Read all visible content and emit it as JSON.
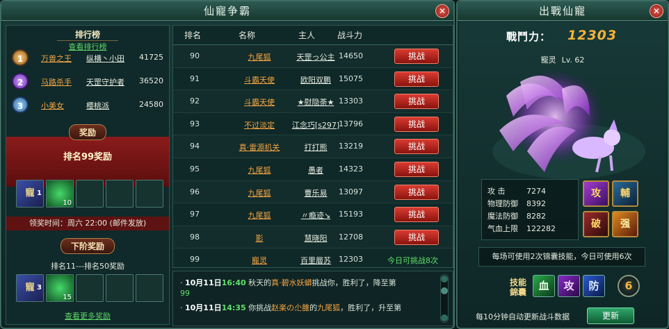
{
  "left_window": {
    "title": "仙寵争霸",
    "close_glyph": "✕"
  },
  "sidebar": {
    "rank_header": "排行榜",
    "view_rank_link": "查看排行榜",
    "top_ranks": [
      {
        "medal": "1",
        "title": "万兽之王",
        "name": "纵横丶小田",
        "power": "41725"
      },
      {
        "medal": "2",
        "title": "马路杀手",
        "name": "天罡守护者",
        "power": "36520"
      },
      {
        "medal": "3",
        "title": "小美女",
        "name": "樱桃派",
        "power": "24580"
      }
    ],
    "reward_header": "奖励",
    "reward_title": "排名99奖励",
    "reward_items": [
      {
        "icon": "pet-scroll-icon",
        "glyph": "寵",
        "qty": "1"
      },
      {
        "icon": "green-gem-icon",
        "glyph": "",
        "qty": "10"
      }
    ],
    "claim_time": "领奖时间：周六 22:00 (邮件发放)",
    "next_header": "下阶奖励",
    "next_range": "排名11---排名50奖励",
    "next_items": [
      {
        "icon": "pet-scroll-icon",
        "glyph": "寵",
        "qty": "3"
      },
      {
        "icon": "green-gem-icon",
        "glyph": "",
        "qty": "15"
      }
    ],
    "more_rewards_link": "查看更多奖励"
  },
  "table": {
    "headers": {
      "rank": "排名",
      "name": "名称",
      "owner": "主人",
      "power": "战斗力"
    },
    "challenge_label": "挑战",
    "rows": [
      {
        "rank": "90",
        "name": "九尾狐",
        "owner": "天罡っ公主",
        "power": "14650",
        "action": "button"
      },
      {
        "rank": "91",
        "name": "斗霸天使",
        "owner": "欧阳双鹏",
        "power": "15075",
        "action": "button"
      },
      {
        "rank": "92",
        "name": "斗霸天使",
        "owner": "★慰隐荼★",
        "power": "13303",
        "action": "button"
      },
      {
        "rank": "93",
        "name": "不过淡定",
        "owner": "江念巧[s297]",
        "power": "13796",
        "action": "button"
      },
      {
        "rank": "94",
        "name": "真·雷源机关",
        "owner": "打打熊",
        "power": "13219",
        "action": "button"
      },
      {
        "rank": "95",
        "name": "九尾狐",
        "owner": "愚者",
        "power": "14323",
        "action": "button"
      },
      {
        "rank": "96",
        "name": "九尾狐",
        "owner": "曹乐易",
        "power": "13097",
        "action": "button"
      },
      {
        "rank": "97",
        "name": "九尾狐",
        "owner": "〃瘾迹↘",
        "power": "15193",
        "action": "button"
      },
      {
        "rank": "98",
        "name": "影",
        "owner": "慧晓阳",
        "power": "12708",
        "action": "button"
      },
      {
        "rank": "99",
        "name": "寵灵",
        "owner": "百里層苏",
        "power": "12303",
        "action": "note"
      }
    ],
    "self_note": "今日可挑战8次"
  },
  "log": {
    "entries": [
      {
        "bullet": "·",
        "date": "10月11日",
        "time": "16:40",
        "t1": " 秋天的",
        "t2": "真·碧水妖蟒",
        "t3": "挑战你，胜利了，降至第",
        "t4": "99"
      },
      {
        "bullet": "·",
        "date": "10月11日",
        "time": "14:35",
        "t1": " 你挑战",
        "t2": "赵楽の尐雒",
        "t3": "的",
        "t4": "九尾狐",
        "t5": "，胜利了，升至第"
      }
    ]
  },
  "right_window": {
    "title": "出戰仙寵",
    "close_glyph": "✕",
    "power_label": "戰鬥力：",
    "power_value": "12303",
    "pet_name": "寵灵",
    "pet_level": "Lv. 62",
    "stats": [
      {
        "label": "攻  击",
        "value": "7274"
      },
      {
        "label": "物理防御",
        "value": "8392"
      },
      {
        "label": "魔法防御",
        "value": "8282"
      },
      {
        "label": "气血上限",
        "value": "122282"
      }
    ],
    "skills": [
      {
        "glyph": "攻",
        "icon": "attack-skill-icon"
      },
      {
        "glyph": "輔",
        "icon": "support-skill-icon"
      },
      {
        "glyph": "破",
        "icon": "break-skill-icon"
      },
      {
        "glyph": "强",
        "icon": "strong-skill-icon"
      }
    ],
    "usage_notice": "每场可使用2次锦囊技能，今日可使用6次",
    "kit_label": "技能錦囊",
    "kits": [
      {
        "glyph": "血",
        "icon": "blood-kit-icon"
      },
      {
        "glyph": "攻",
        "icon": "attack-kit-icon"
      },
      {
        "glyph": "防",
        "icon": "defense-kit-icon"
      }
    ],
    "kit_count": "6",
    "footer_note": "每10分钟自动更新战斗数据",
    "refresh_label": "更新"
  },
  "colors": {
    "accent_orange": "#f2a542",
    "accent_green": "#5fe06a",
    "button_red": "#d93b31",
    "power_gold": "#f5b33a"
  }
}
